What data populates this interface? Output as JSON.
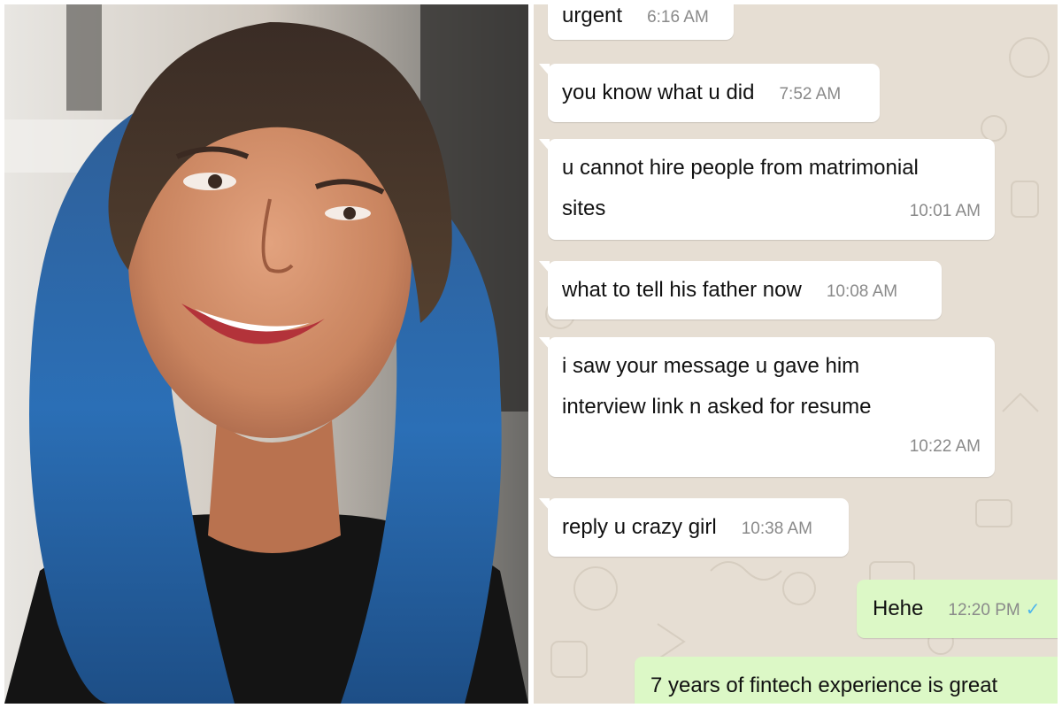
{
  "photo": {
    "description_icon": "portrait-photo"
  },
  "colors": {
    "incoming_bubble": "#ffffff",
    "outgoing_bubble": "#dcf8c6",
    "chat_background": "#e6ded3",
    "timestamp": "#8a8a8a",
    "read_receipt": "#4fb6ec"
  },
  "messages": [
    {
      "direction": "in",
      "text": "urgent",
      "time": "6:16 AM"
    },
    {
      "direction": "in",
      "text": "you know what u did",
      "time": "7:52 AM"
    },
    {
      "direction": "in",
      "text": "u cannot hire people from matrimonial\nsites",
      "time": "10:01 AM"
    },
    {
      "direction": "in",
      "text": "what to tell his father now",
      "time": "10:08 AM"
    },
    {
      "direction": "in",
      "text": "i saw your message u gave him\ninterview link n asked for resume",
      "time": "10:22 AM"
    },
    {
      "direction": "in",
      "text": "reply u crazy girl",
      "time": "10:38 AM"
    },
    {
      "direction": "out",
      "text": "Hehe",
      "time": "12:20 PM",
      "status_icon": "double-check-icon"
    },
    {
      "direction": "out",
      "text": "7 years of fintech experience is great",
      "time": ""
    }
  ]
}
